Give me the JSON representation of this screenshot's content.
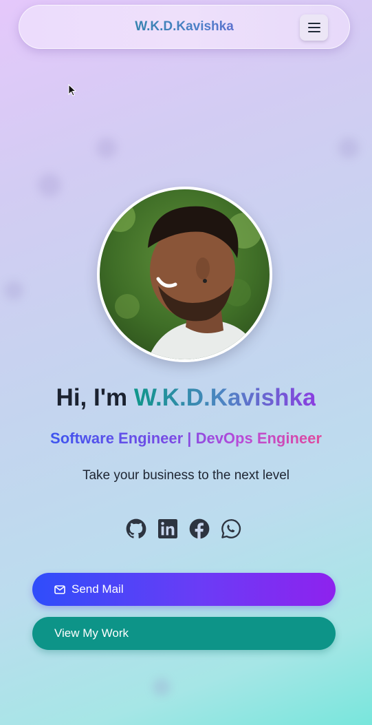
{
  "navbar": {
    "brand": "W.K.D.Kavishka",
    "menu_icon": "hamburger-menu-icon"
  },
  "hero": {
    "greeting_prefix": "Hi, I'm ",
    "name": "W.K.D.Kavishka",
    "roles": "Software Engineer | DevOps Engineer",
    "tagline": "Take your business to the next level",
    "avatar_icon": "profile-photo"
  },
  "socials": [
    {
      "icon": "github-icon"
    },
    {
      "icon": "linkedin-icon"
    },
    {
      "icon": "facebook-icon"
    },
    {
      "icon": "whatsapp-icon"
    }
  ],
  "buttons": {
    "send_mail": "Send Mail",
    "view_work": "View My Work"
  },
  "colors": {
    "primary_gradient_start": "#2f4dfa",
    "primary_gradient_end": "#8e22ee",
    "teal": "#0d9488",
    "text_dark": "#1b2230"
  }
}
